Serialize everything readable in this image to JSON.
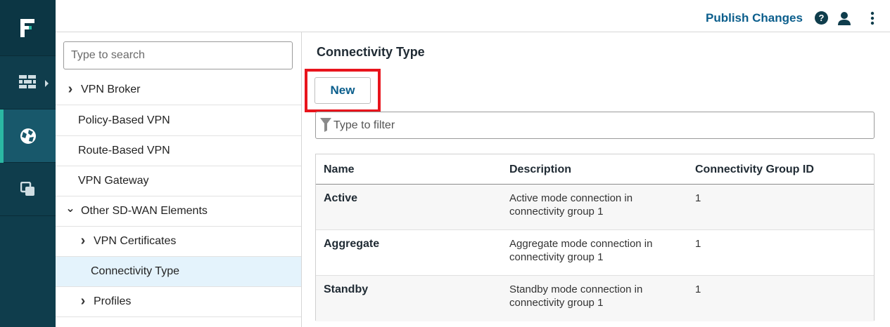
{
  "topbar": {
    "publish_label": "Publish Changes",
    "help_label": "?"
  },
  "tree": {
    "search_placeholder": "Type to search",
    "items": [
      {
        "label": "VPN Broker",
        "expander": "collapsed"
      },
      {
        "label": "Policy-Based VPN"
      },
      {
        "label": "Route-Based VPN"
      },
      {
        "label": "VPN Gateway"
      },
      {
        "label": "Other SD-WAN Elements",
        "expander": "expanded"
      },
      {
        "label": "VPN Certificates",
        "expander": "collapsed"
      },
      {
        "label": "Connectivity Type",
        "selected": true
      },
      {
        "label": "Profiles",
        "expander": "collapsed"
      }
    ]
  },
  "main": {
    "title": "Connectivity Type",
    "new_label": "New",
    "filter_placeholder": "Type to filter",
    "columns": [
      "Name",
      "Description",
      "Connectivity Group ID"
    ],
    "rows": [
      {
        "name": "Active",
        "description": "Active mode connection in connectivity group 1",
        "group_id": "1"
      },
      {
        "name": "Aggregate",
        "description": "Aggregate mode connection in connectivity group 1",
        "group_id": "1"
      },
      {
        "name": "Standby",
        "description": "Standby mode connection in connectivity group 1",
        "group_id": "1"
      }
    ]
  },
  "colors": {
    "rail": "#0f3d4c",
    "rail_active": "#18586b",
    "accent": "#2bb8a3",
    "link": "#0b5e8c",
    "highlight": "#e8141c",
    "selected_row": "#e4f3fc"
  },
  "icons": {
    "logo": "forcepoint-logo-icon",
    "nav": [
      "firewall-icon",
      "globe-network-icon",
      "copy-windows-icon"
    ],
    "top": [
      "help-icon",
      "user-icon",
      "kebab-menu-icon"
    ],
    "filter": "funnel-icon"
  }
}
